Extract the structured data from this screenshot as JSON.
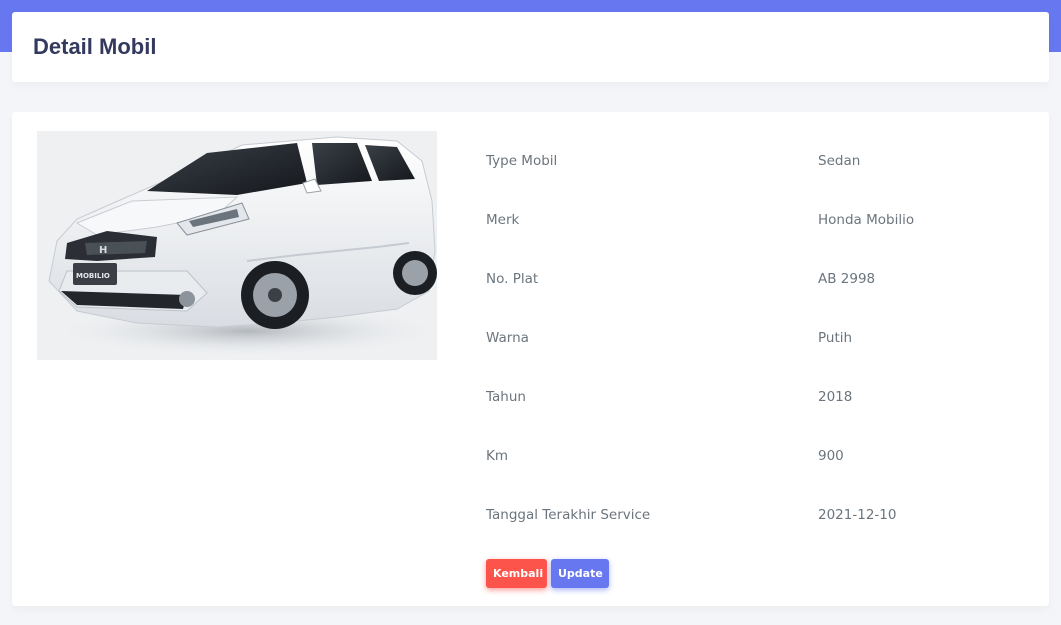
{
  "header": {
    "title": "Detail Mobil"
  },
  "car": {
    "image_icon": "white-honda-mobilio-car",
    "image_label": "MOBILIO"
  },
  "details": [
    {
      "label": "Type Mobil",
      "value": "Sedan"
    },
    {
      "label": "Merk",
      "value": "Honda Mobilio"
    },
    {
      "label": "No. Plat",
      "value": "AB 2998"
    },
    {
      "label": "Warna",
      "value": "Putih"
    },
    {
      "label": "Tahun",
      "value": "2018"
    },
    {
      "label": "Km",
      "value": "900"
    },
    {
      "label": "Tanggal Terakhir Service",
      "value": "2021-12-10"
    }
  ],
  "actions": {
    "back_label": "Kembali",
    "update_label": "Update"
  },
  "colors": {
    "primary": "#6777ef",
    "danger": "#fc544b",
    "title": "#34395e"
  }
}
